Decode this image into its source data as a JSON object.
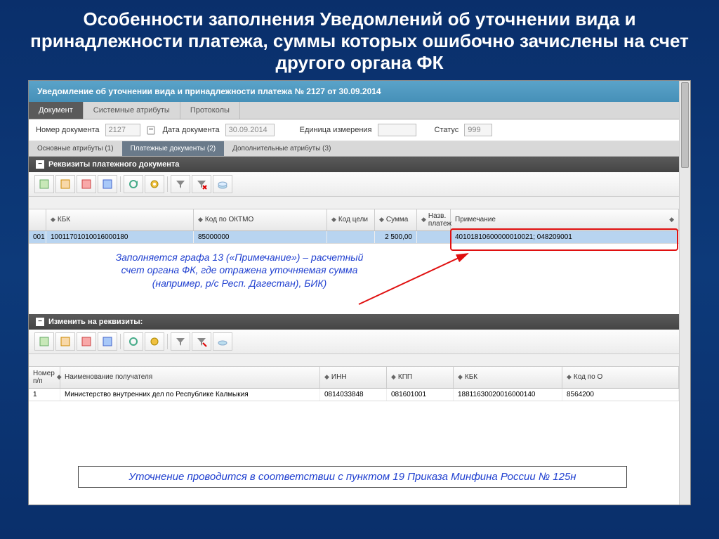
{
  "slide": {
    "title": "Особенности заполнения Уведомлений об уточнении вида и принадлежности платежа, суммы которых ошибочно зачислены на счет другого органа ФК"
  },
  "app": {
    "window_title": "Уведомление об уточнении вида и принадлежности платежа № 2127 от 30.09.2014",
    "main_tabs": [
      "Документ",
      "Системные атрибуты",
      "Протоколы"
    ],
    "form": {
      "doc_num_label": "Номер документа",
      "doc_num": "2127",
      "doc_date_label": "Дата документа",
      "doc_date": "30.09.2014",
      "unit_label": "Единица измерения",
      "unit": "",
      "status_label": "Статус",
      "status": "999"
    },
    "sub_tabs": [
      "Основные атрибуты (1)",
      "Платежные документы (2)",
      "Дополнительные атрибуты (3)"
    ]
  },
  "panel1": {
    "title": "Реквизиты платежного документа",
    "headers": {
      "kbk": "КБК",
      "oktmo": "Код по ОКТМО",
      "goal": "Код цели",
      "sum": "Сумма",
      "platezh": "Назв. платеж",
      "note": "Примечание"
    },
    "row": {
      "idx": "001",
      "kbk": "10011701010016000180",
      "oktmo": "85000000",
      "goal": "",
      "sum": "2 500,00",
      "platezh": "",
      "note": "40101810600000010021; 048209001"
    }
  },
  "panel2": {
    "title": "Изменить на реквизиты:",
    "headers": {
      "num": "Номер п/п",
      "name": "Наименование получателя",
      "inn": "ИНН",
      "kpp": "КПП",
      "kbk": "КБК",
      "oktmo": "Код по О"
    },
    "row": {
      "num": "1",
      "name": "Министерство внутренних дел по Республике Калмыкия",
      "inn": "0814033848",
      "kpp": "081601001",
      "kbk": "18811630020016000140",
      "oktmo": "8564200"
    }
  },
  "annotation": {
    "text": "Заполняется графа 13 («Примечание») – расчетный\nсчет органа ФК, где отражена уточняемая сумма\n(например, р/с Респ. Дагестан), БИК)"
  },
  "note": {
    "text": "Уточнение проводится в соответствии с пунктом 19 Приказа Минфина России № 125н"
  }
}
